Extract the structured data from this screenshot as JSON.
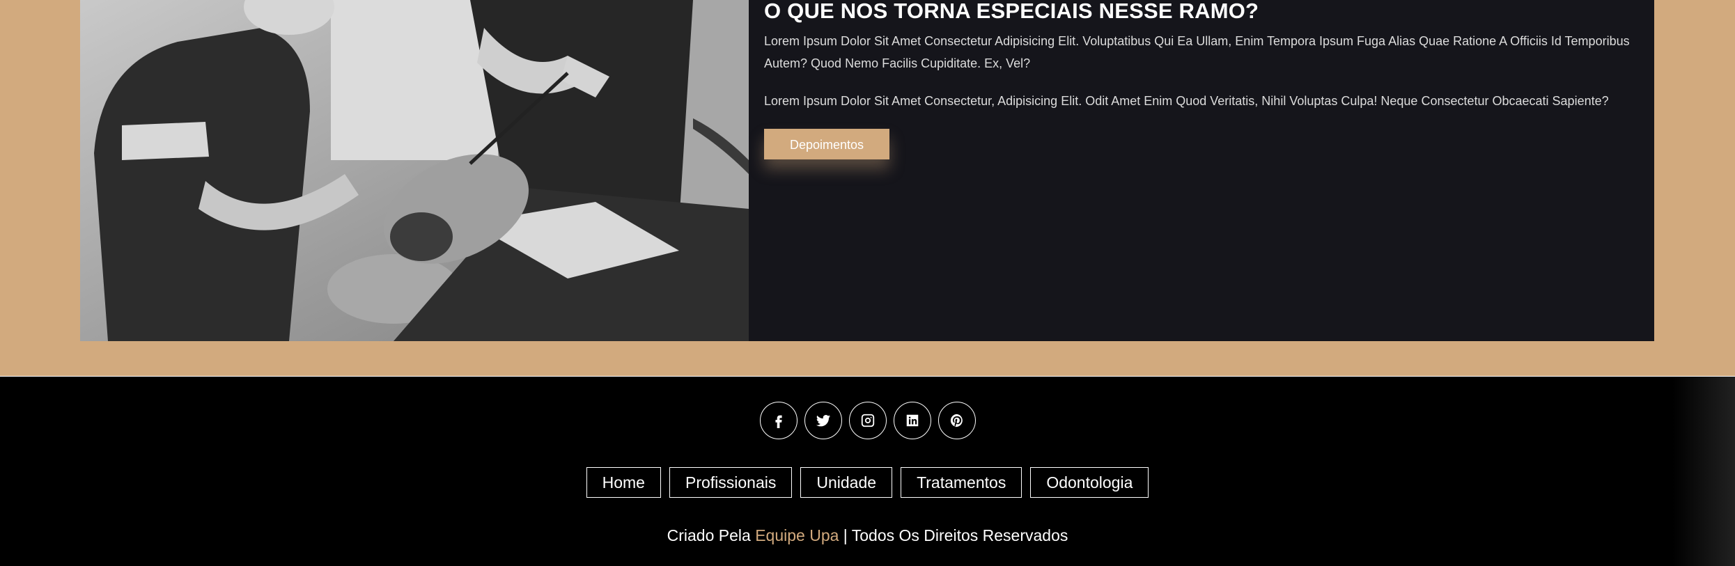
{
  "about": {
    "title": "O QUE NOS TORNA ESPECIAIS NESSE RAMO?",
    "paragraph1": "Lorem Ipsum Dolor Sit Amet Consectetur Adipisicing Elit. Voluptatibus Qui Ea Ullam, Enim Tempora Ipsum Fuga Alias Quae Ratione A Officiis Id Temporibus Autem? Quod Nemo Facilis Cupiditate. Ex, Vel?",
    "paragraph2": "Lorem Ipsum Dolor Sit Amet Consectetur, Adipisicing Elit. Odit Amet Enim Quod Veritatis, Nihil Voluptas Culpa! Neque Consectetur Obcaecati Sapiente?",
    "button_label": "Depoimentos",
    "image_icon": "dentist-treating-patient-photo"
  },
  "footer": {
    "socials": [
      {
        "icon": "facebook-icon"
      },
      {
        "icon": "twitter-icon"
      },
      {
        "icon": "instagram-icon"
      },
      {
        "icon": "linkedin-icon"
      },
      {
        "icon": "pinterest-icon"
      }
    ],
    "nav": [
      "Home",
      "Profissionais",
      "Unidade",
      "Tratamentos",
      "Odontologia"
    ],
    "credits": {
      "prefix": "Criado Pela",
      "brand": "Equipe Upa",
      "suffix": "| Todos Os Direitos Reservados"
    }
  },
  "colors": {
    "accent": "#d2aa7e",
    "card_bg": "#15151b",
    "footer_bg": "#000000"
  }
}
